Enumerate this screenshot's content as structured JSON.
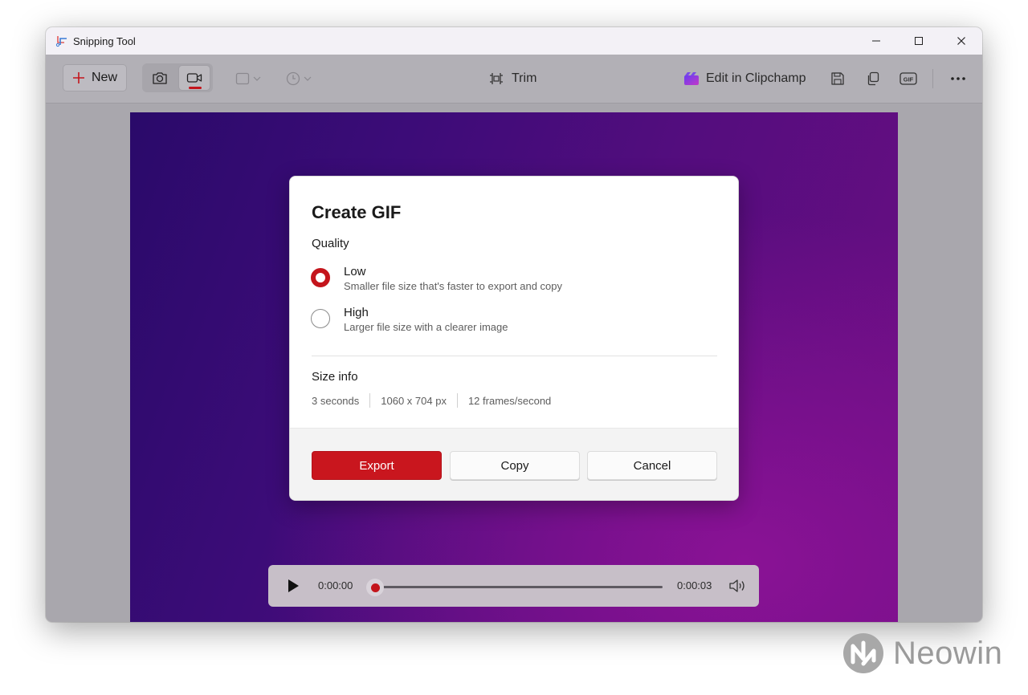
{
  "window": {
    "title": "Snipping Tool",
    "controls": {
      "minimize_icon": "minimize-icon",
      "maximize_icon": "maximize-icon",
      "close_icon": "close-icon"
    }
  },
  "toolbar": {
    "new_label": "New",
    "trim_label": "Trim",
    "clipchamp_label": "Edit in Clipchamp",
    "active_mode": "video",
    "accent_color": "#c4151c"
  },
  "dialog": {
    "title": "Create GIF",
    "quality_heading": "Quality",
    "options": [
      {
        "label": "Low",
        "description": "Smaller file size that's faster to export and copy",
        "selected": true
      },
      {
        "label": "High",
        "description": "Larger file size with a clearer image",
        "selected": false
      }
    ],
    "size_heading": "Size info",
    "size_items": [
      "3 seconds",
      "1060 x 704 px",
      "12 frames/second"
    ],
    "buttons": {
      "export": "Export",
      "copy": "Copy",
      "cancel": "Cancel"
    }
  },
  "player": {
    "current_time": "0:00:00",
    "total_time": "0:00:03",
    "progress": 0
  },
  "watermark": {
    "text": "Neowin"
  }
}
